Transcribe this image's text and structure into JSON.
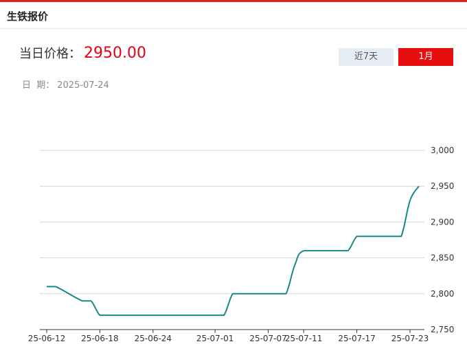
{
  "header": {
    "title": "生铁报价"
  },
  "price": {
    "label": "当日价格：",
    "value": "2950.00"
  },
  "date": {
    "label": "日  期：",
    "value": "2025-07-24"
  },
  "range_buttons": {
    "week_label": "近7天",
    "month_label": "1月",
    "selected": "1月"
  },
  "colors": {
    "accent": "#e60012",
    "line": "#138a8a",
    "button_inactive_bg": "#e6edf4"
  },
  "chart_data": {
    "type": "line",
    "title": "",
    "xlabel": "",
    "ylabel": "",
    "ylim": [
      2750,
      3000
    ],
    "yticks": [
      "3,000",
      "2,950",
      "2,900",
      "2,850",
      "2,800",
      "2,750"
    ],
    "ytick_values": [
      3000,
      2950,
      2900,
      2850,
      2800,
      2750
    ],
    "xticks": [
      "25-06-12",
      "25-06-18",
      "25-06-24",
      "25-07-01",
      "25-07-07",
      "25-07-11",
      "25-07-17",
      "25-07-23"
    ],
    "grid": true,
    "x": [
      "25-06-12",
      "25-06-13",
      "25-06-16",
      "25-06-17",
      "25-06-18",
      "25-06-19",
      "25-06-20",
      "25-06-23",
      "25-06-24",
      "25-06-25",
      "25-06-26",
      "25-06-27",
      "25-06-30",
      "25-07-01",
      "25-07-02",
      "25-07-03",
      "25-07-04",
      "25-07-07",
      "25-07-08",
      "25-07-09",
      "25-07-10",
      "25-07-11",
      "25-07-14",
      "25-07-15",
      "25-07-16",
      "25-07-17",
      "25-07-18",
      "25-07-21",
      "25-07-22",
      "25-07-23",
      "25-07-24"
    ],
    "series": [
      {
        "values": [
          2810,
          2810,
          2790,
          2790,
          2770,
          2770,
          2770,
          2770,
          2770,
          2770,
          2770,
          2770,
          2770,
          2770,
          2770,
          2800,
          2800,
          2800,
          2800,
          2800,
          2840,
          2860,
          2860,
          2860,
          2860,
          2880,
          2880,
          2880,
          2880,
          2930,
          2950
        ]
      }
    ]
  }
}
